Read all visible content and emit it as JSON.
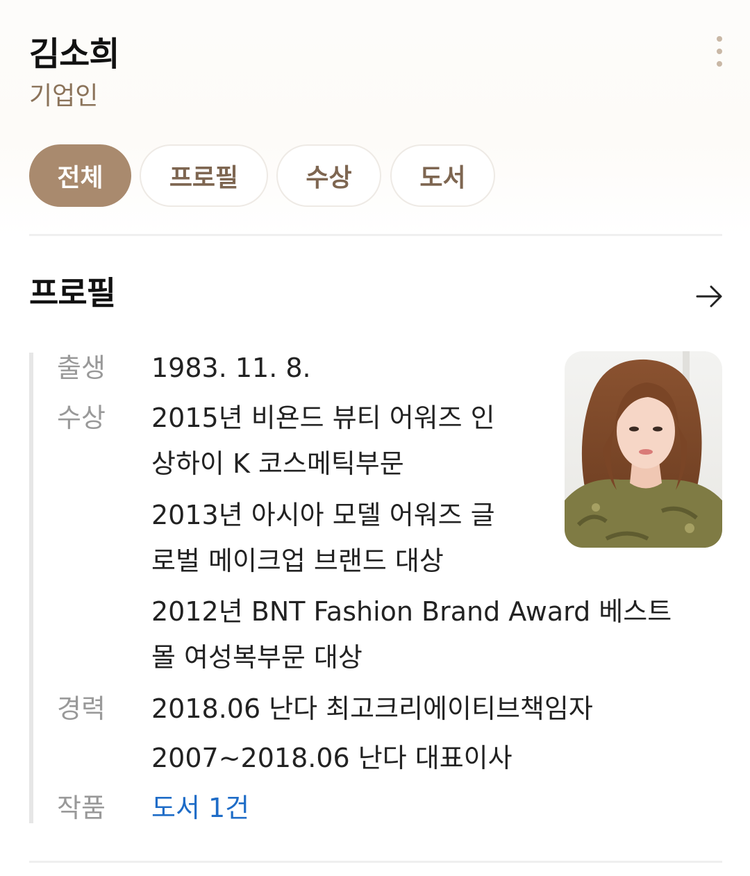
{
  "header": {
    "name": "김소희",
    "occupation": "기업인"
  },
  "tabs": [
    {
      "label": "전체",
      "active": true
    },
    {
      "label": "프로필",
      "active": false
    },
    {
      "label": "수상",
      "active": false
    },
    {
      "label": "도서",
      "active": false
    }
  ],
  "profile": {
    "title": "프로필",
    "rows": {
      "birth": {
        "label": "출생",
        "value": "1983. 11. 8."
      },
      "awards": {
        "label": "수상",
        "lines": [
          "2015년 비욘드 뷰티 어워즈 인",
          "상하이 K 코스메틱부문",
          "2013년 아시아 모델 어워즈 글",
          "로벌 메이크업 브랜드 대상",
          "2012년 BNT Fashion Brand Award 베스트",
          "몰 여성복부문 대상"
        ]
      },
      "career": {
        "label": "경력",
        "lines": [
          "2018.06 난다 최고크리에이티브책임자",
          "2007~2018.06 난다 대표이사"
        ]
      },
      "works": {
        "label": "작품",
        "value": "도서 1건"
      }
    }
  },
  "colors": {
    "accent": "#a98a6e",
    "tab_text": "#7e6651",
    "occupation": "#8b735a",
    "link": "#1e6cc7",
    "label_gray": "#999999"
  },
  "icons": {
    "more": "more-vertical-icon",
    "arrow": "arrow-right-icon"
  }
}
